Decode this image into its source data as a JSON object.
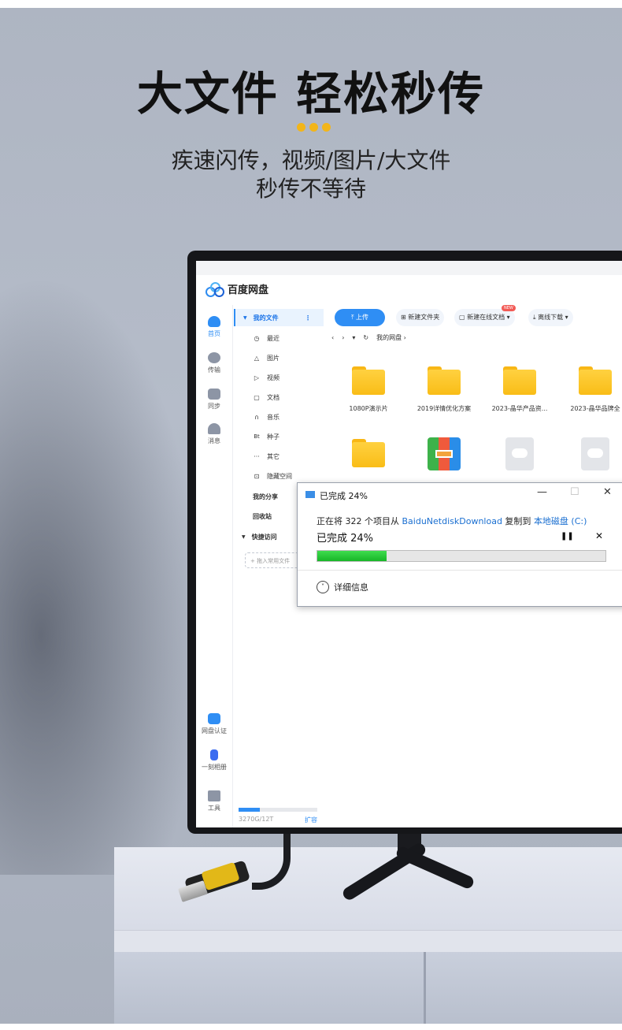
{
  "hero": {
    "headline": "大文件 轻松秒传",
    "subline1": "疾速闪传，视频/图片/大文件",
    "subline2": "秒传不等待"
  },
  "colors": {
    "accent": "#f2b519",
    "brand": "#2f8ef4",
    "progress": "#17b527"
  },
  "app": {
    "brand": "百度网盘",
    "left_nav": [
      {
        "label": "首页",
        "icon": "home-icon"
      },
      {
        "label": "传输",
        "icon": "transfer-icon"
      },
      {
        "label": "同步",
        "icon": "sync-icon"
      },
      {
        "label": "消息",
        "icon": "message-icon"
      },
      {
        "label": "网盘认证",
        "icon": "verify-icon"
      },
      {
        "label": "一刻相册",
        "icon": "album-icon"
      },
      {
        "label": "工具",
        "icon": "tools-icon"
      }
    ],
    "nav_header": "我的文件",
    "nav_items": [
      {
        "label": "最近",
        "icon": "clock-icon"
      },
      {
        "label": "图片",
        "icon": "image-icon"
      },
      {
        "label": "视频",
        "icon": "play-icon"
      },
      {
        "label": "文档",
        "icon": "document-icon"
      },
      {
        "label": "音乐",
        "icon": "headphones-icon"
      },
      {
        "label": "种子",
        "icon": "bt-icon"
      },
      {
        "label": "其它",
        "icon": "more-icon"
      },
      {
        "label": "隐藏空间",
        "icon": "lock-icon"
      }
    ],
    "my_share": "我的分享",
    "recycle": "回收站",
    "quick_access": "快捷访问",
    "add_common": "+ 拖入常用文件",
    "storage": {
      "text": "3270G/12T",
      "link": "扩容",
      "used_fraction": 0.27
    },
    "toolbar": {
      "upload": "上传",
      "new_folder": "新建文件夹",
      "new_doc": "新建在线文档",
      "new_badge": "NEW",
      "offline": "离线下载"
    },
    "path": {
      "root": "我的网盘"
    },
    "files": [
      {
        "name": "1080P演示片",
        "type": "folder"
      },
      {
        "name": "2019详情优化方案",
        "type": "folder"
      },
      {
        "name": "2023-晶华产品资...",
        "type": "folder"
      },
      {
        "name": "2023-晶华品牌全",
        "type": "folder"
      },
      {
        "name": "",
        "type": "folder"
      },
      {
        "name": "",
        "type": "archive"
      },
      {
        "name": "",
        "type": "cloud-file"
      },
      {
        "name": "",
        "type": "cloud-file"
      }
    ]
  },
  "dialog": {
    "title": "已完成 24%",
    "line_prefix": "正在将 322 个项目从 ",
    "source": "BaiduNetdiskDownload",
    "line_mid": " 复制到 ",
    "dest": "本地磁盘 (C:)",
    "percent_label": "已完成 24%",
    "progress": 0.24,
    "details": "详细信息",
    "min": "—",
    "max": "☐",
    "close": "✕"
  }
}
